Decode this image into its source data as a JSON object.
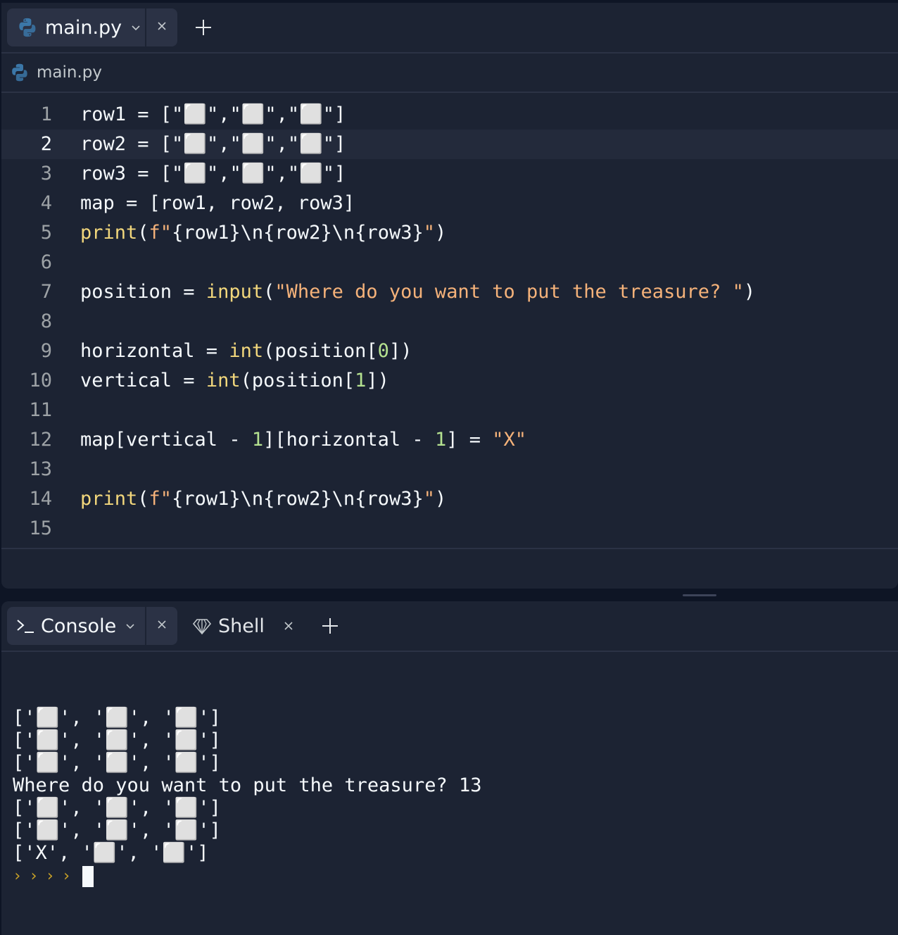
{
  "editor": {
    "tab": {
      "label": "main.py"
    },
    "filepath": "main.py",
    "active_line": 2,
    "lines": [
      {
        "n": "1",
        "t": [
          [
            "row1 = [\"",
            ""
          ],
          [
            "⬜",
            "str"
          ],
          [
            "\",\"",
            ""
          ],
          [
            "⬜",
            "str"
          ],
          [
            "\",\"",
            ""
          ],
          [
            "⬜",
            "str"
          ],
          [
            "\"]",
            ""
          ]
        ]
      },
      {
        "n": "2",
        "t": [
          [
            "row2 = [\"",
            ""
          ],
          [
            "⬜",
            "str"
          ],
          [
            "\",\"",
            ""
          ],
          [
            "⬜",
            "str"
          ],
          [
            "\",\"",
            ""
          ],
          [
            "⬜",
            "str"
          ],
          [
            "\"]",
            ""
          ]
        ]
      },
      {
        "n": "3",
        "t": [
          [
            "row3 = [\"",
            ""
          ],
          [
            "⬜",
            "str"
          ],
          [
            "\",\"",
            ""
          ],
          [
            "⬜",
            "str"
          ],
          [
            "\",\"",
            ""
          ],
          [
            "⬜",
            "str"
          ],
          [
            "\"]",
            ""
          ]
        ]
      },
      {
        "n": "4",
        "t": [
          [
            "map = [row1, row2, row3]",
            ""
          ]
        ]
      },
      {
        "n": "5",
        "t": [
          [
            "print",
            "fn"
          ],
          [
            "(",
            ""
          ],
          [
            "f\"",
            "str"
          ],
          [
            "{row1}",
            ""
          ],
          [
            "\\n",
            "esc"
          ],
          [
            "{row2}",
            ""
          ],
          [
            "\\n",
            "esc"
          ],
          [
            "{row3}",
            ""
          ],
          [
            "\"",
            "str"
          ],
          [
            ")",
            ""
          ]
        ]
      },
      {
        "n": "6",
        "t": []
      },
      {
        "n": "7",
        "t": [
          [
            "position = ",
            ""
          ],
          [
            "input",
            "fn"
          ],
          [
            "(",
            ""
          ],
          [
            "\"Where do you want to put the treasure? \"",
            "str"
          ],
          [
            ")",
            ""
          ]
        ]
      },
      {
        "n": "8",
        "t": []
      },
      {
        "n": "9",
        "t": [
          [
            "horizontal = ",
            ""
          ],
          [
            "int",
            "fn"
          ],
          [
            "(position[",
            ""
          ],
          [
            "0",
            "num"
          ],
          [
            "])",
            ""
          ]
        ]
      },
      {
        "n": "10",
        "t": [
          [
            "vertical = ",
            ""
          ],
          [
            "int",
            "fn"
          ],
          [
            "(position[",
            ""
          ],
          [
            "1",
            "num"
          ],
          [
            "])",
            ""
          ]
        ]
      },
      {
        "n": "11",
        "t": []
      },
      {
        "n": "12",
        "t": [
          [
            "map[vertical - ",
            ""
          ],
          [
            "1",
            "num"
          ],
          [
            "][horizontal - ",
            ""
          ],
          [
            "1",
            "num"
          ],
          [
            "] = ",
            ""
          ],
          [
            "\"X\"",
            "str"
          ]
        ]
      },
      {
        "n": "13",
        "t": []
      },
      {
        "n": "14",
        "t": [
          [
            "print",
            "fn"
          ],
          [
            "(",
            ""
          ],
          [
            "f\"",
            "str"
          ],
          [
            "{row1}",
            ""
          ],
          [
            "\\n",
            "esc"
          ],
          [
            "{row2}",
            ""
          ],
          [
            "\\n",
            "esc"
          ],
          [
            "{row3}",
            ""
          ],
          [
            "\"",
            "str"
          ],
          [
            ")",
            ""
          ]
        ]
      },
      {
        "n": "15",
        "t": []
      }
    ]
  },
  "console": {
    "tabs": {
      "console_label": "Console",
      "shell_label": "Shell"
    },
    "output": [
      "['⬜', '⬜', '⬜']",
      "['⬜', '⬜', '⬜']",
      "['⬜', '⬜', '⬜']",
      "Where do you want to put the treasure? 13",
      "['⬜', '⬜', '⬜']",
      "['⬜', '⬜', '⬜']",
      "['X', '⬜', '⬜']"
    ],
    "prompt_chevrons": "››››"
  },
  "colors": {
    "background": "#0e1525",
    "panel": "#1c2333",
    "tab": "#2b3245",
    "function": "#f2d77c",
    "string": "#f5b27a",
    "number": "#b5e290",
    "prompt": "#c9a227"
  }
}
